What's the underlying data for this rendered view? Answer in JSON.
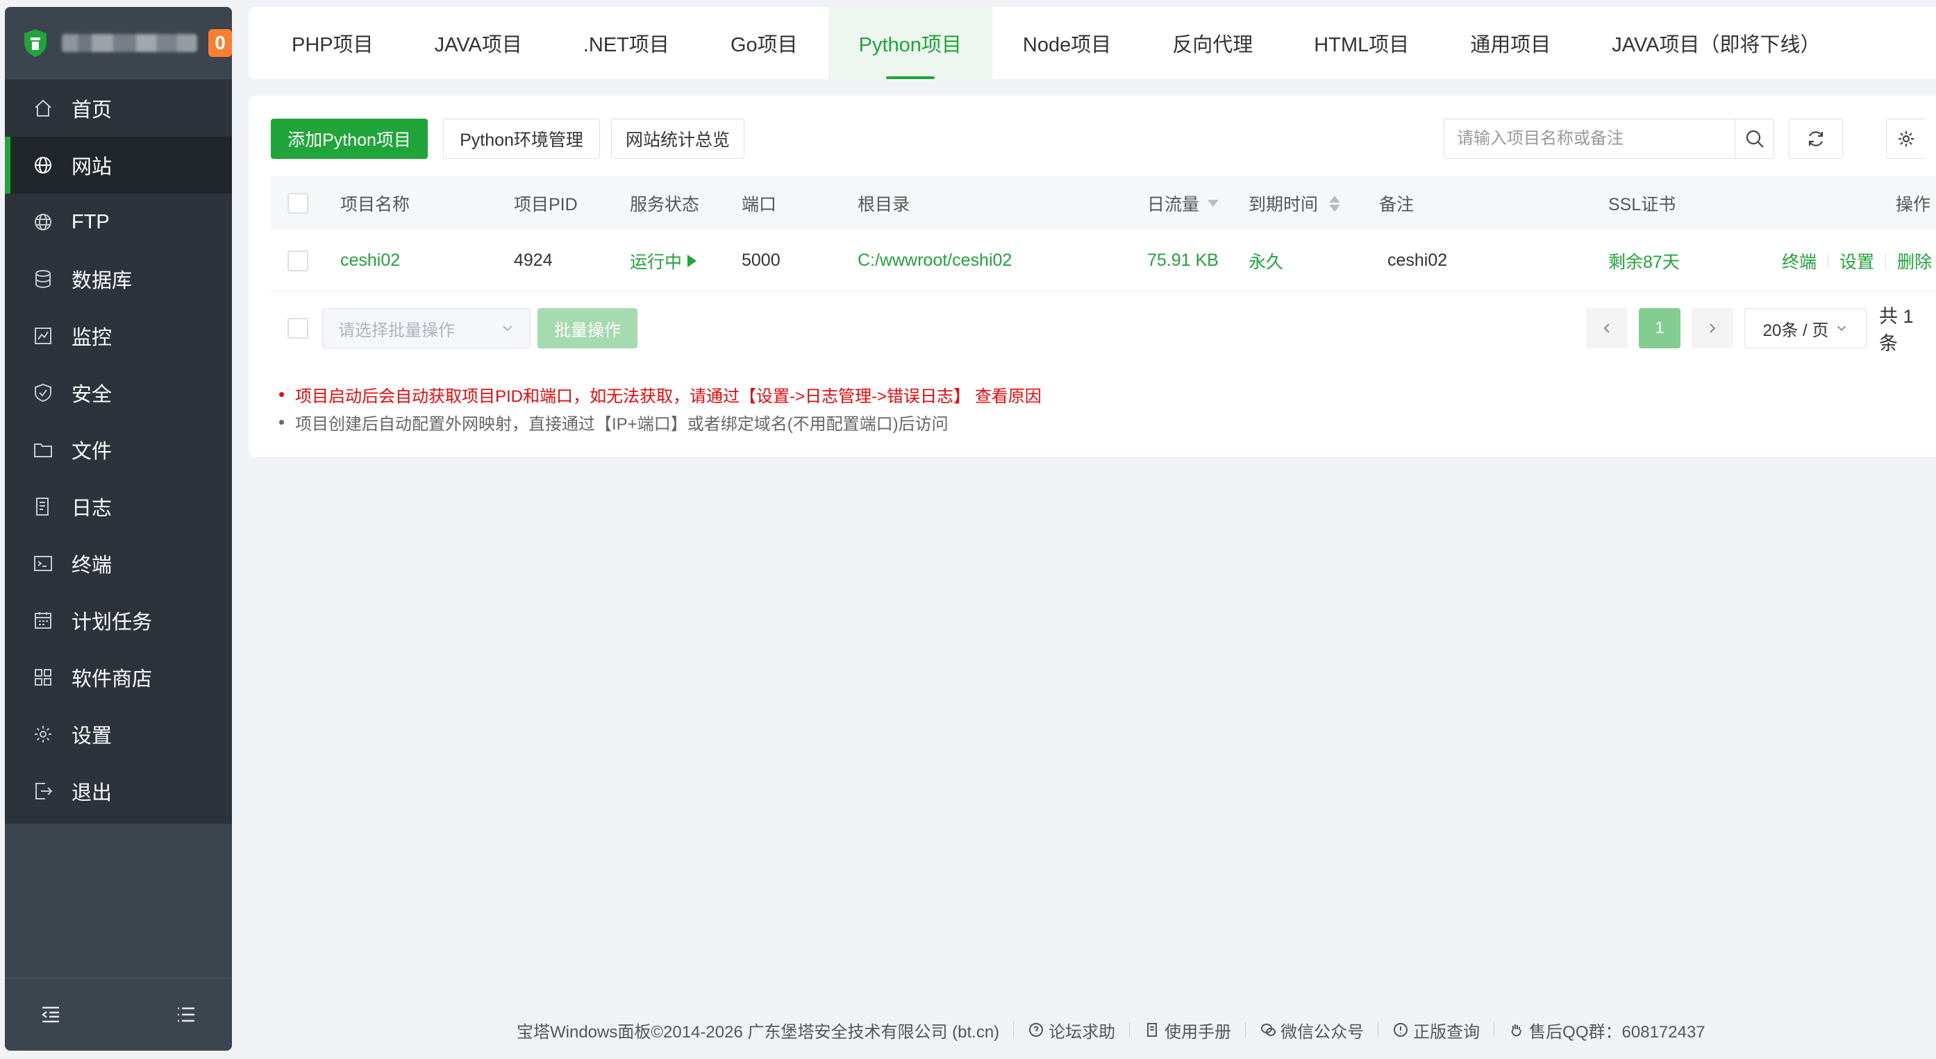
{
  "sidebar": {
    "badge": "0",
    "items": [
      {
        "label": "首页",
        "icon": "home-icon"
      },
      {
        "label": "网站",
        "icon": "globe-icon"
      },
      {
        "label": "FTP",
        "icon": "ftp-icon"
      },
      {
        "label": "数据库",
        "icon": "database-icon"
      },
      {
        "label": "监控",
        "icon": "monitor-icon"
      },
      {
        "label": "安全",
        "icon": "shield-icon"
      },
      {
        "label": "文件",
        "icon": "folder-icon"
      },
      {
        "label": "日志",
        "icon": "log-icon"
      },
      {
        "label": "终端",
        "icon": "terminal-icon"
      },
      {
        "label": "计划任务",
        "icon": "calendar-icon"
      },
      {
        "label": "软件商店",
        "icon": "apps-icon"
      },
      {
        "label": "设置",
        "icon": "gear-icon"
      },
      {
        "label": "退出",
        "icon": "logout-icon"
      }
    ],
    "active_index": 1
  },
  "tabs": [
    "PHP项目",
    "JAVA项目",
    ".NET项目",
    "Go项目",
    "Python项目",
    "Node项目",
    "反向代理",
    "HTML项目",
    "通用项目",
    "JAVA项目（即将下线）"
  ],
  "active_tab": 4,
  "toolbar": {
    "add_label": "添加Python项目",
    "env_label": "Python环境管理",
    "stats_label": "网站统计总览",
    "search_placeholder": "请输入项目名称或备注"
  },
  "table": {
    "headers": {
      "name": "项目名称",
      "pid": "项目PID",
      "status": "服务状态",
      "port": "端口",
      "root": "根目录",
      "traffic": "日流量",
      "expire": "到期时间",
      "remark": "备注",
      "ssl": "SSL证书",
      "ops": "操作"
    },
    "rows": [
      {
        "name": "ceshi02",
        "pid": "4924",
        "status": "运行中",
        "port": "5000",
        "root": "C:/wwwroot/ceshi02",
        "traffic": "75.91 KB",
        "expire": "永久",
        "remark": "ceshi02",
        "ssl": "剩余87天",
        "ops": [
          "终端",
          "设置",
          "删除"
        ]
      }
    ]
  },
  "bulk": {
    "placeholder": "请选择批量操作",
    "button": "批量操作"
  },
  "pager": {
    "current": "1",
    "page_size": "20条 / 页",
    "total": "共 1 条"
  },
  "notes": [
    "项目启动后会自动获取项目PID和端口，如无法获取，请通过【设置->日志管理->错误日志】 查看原因",
    "项目创建后自动配置外网映射，直接通过【IP+端口】或者绑定域名(不用配置端口)后访问"
  ],
  "footer": {
    "copyright": "宝塔Windows面板©2014-2026 广东堡塔安全技术有限公司 (bt.cn)",
    "links": [
      "论坛求助",
      "使用手册",
      "微信公众号",
      "正版查询",
      "售后QQ群：608172437"
    ]
  },
  "colors": {
    "accent": "#20a53a",
    "sidebar": "#3c444d",
    "warning": "#ef0808",
    "badge": "#fb7f2e"
  }
}
